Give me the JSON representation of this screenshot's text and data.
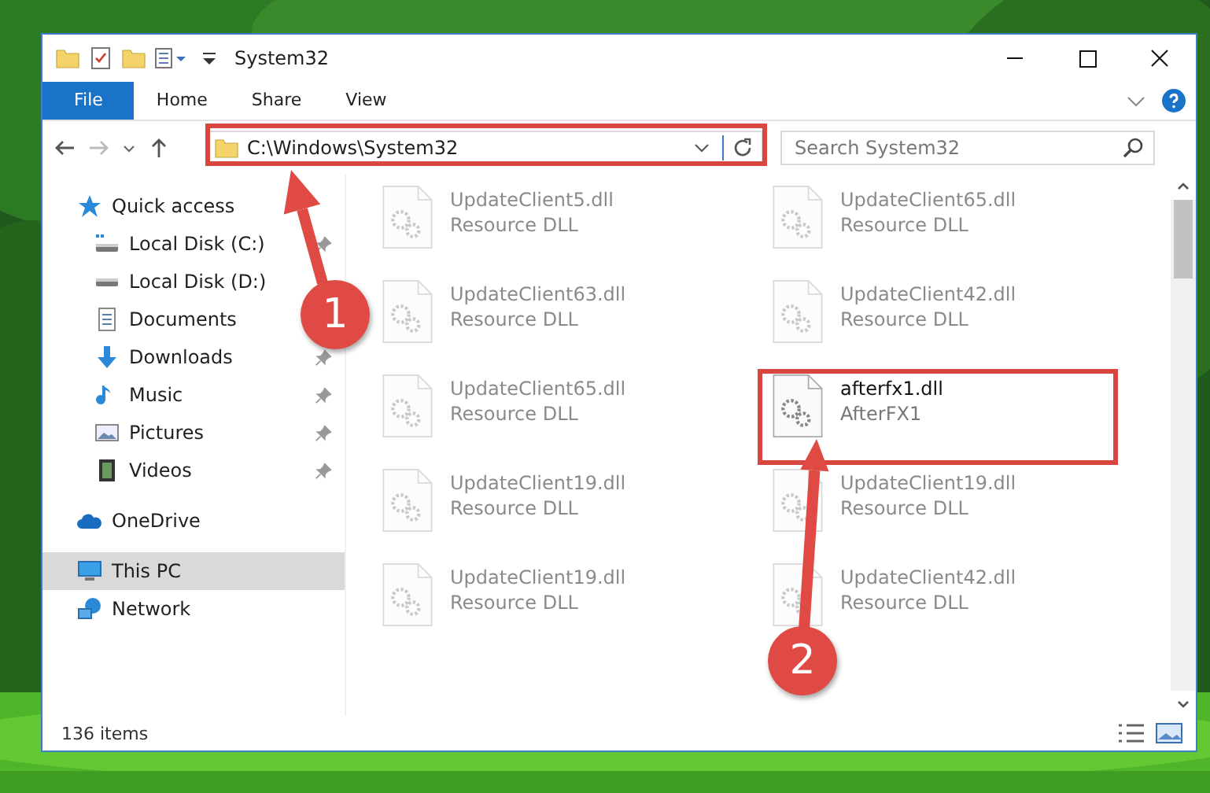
{
  "window": {
    "title": "System32"
  },
  "ribbon_tabs": [
    {
      "label": "File",
      "kind": "file",
      "selected": false
    },
    {
      "label": "Home",
      "kind": "tab",
      "selected": false
    },
    {
      "label": "Share",
      "kind": "tab",
      "selected": false
    },
    {
      "label": "View",
      "kind": "tab",
      "selected": false
    }
  ],
  "address_bar": {
    "path": "C:\\Windows\\System32"
  },
  "search": {
    "placeholder": "Search System32"
  },
  "sidebar": {
    "sections": [
      {
        "label": "Quick access",
        "kind": "star",
        "selected": false,
        "children": [
          {
            "label": "Local Disk (C:)",
            "kind": "disk-c",
            "pinned": true
          },
          {
            "label": "Local Disk (D:)",
            "kind": "disk",
            "pinned": false
          },
          {
            "label": "Documents",
            "kind": "documents",
            "pinned": false
          },
          {
            "label": "Downloads",
            "kind": "downloads",
            "pinned": true
          },
          {
            "label": "Music",
            "kind": "music",
            "pinned": true
          },
          {
            "label": "Pictures",
            "kind": "pictures",
            "pinned": true
          },
          {
            "label": "Videos",
            "kind": "videos",
            "pinned": true
          }
        ]
      },
      {
        "label": "OneDrive",
        "kind": "cloud",
        "selected": false
      },
      {
        "label": "This PC",
        "kind": "pc",
        "selected": true
      },
      {
        "label": "Network",
        "kind": "network",
        "selected": false
      }
    ]
  },
  "files": [
    {
      "name": "UpdateClient5.dll",
      "type": "Resource DLL",
      "faded": true
    },
    {
      "name": "UpdateClient65.dll",
      "type": "Resource DLL",
      "faded": true
    },
    {
      "name": "UpdateClient63.dll",
      "type": "Resource DLL",
      "faded": true
    },
    {
      "name": "UpdateClient42.dll",
      "type": "Resource DLL",
      "faded": true
    },
    {
      "name": "UpdateClient65.dll",
      "type": "Resource DLL",
      "faded": true
    },
    {
      "name": "afterfx1.dll",
      "type": "AfterFX1",
      "faded": false
    },
    {
      "name": "UpdateClient19.dll",
      "type": "Resource DLL",
      "faded": true
    },
    {
      "name": "UpdateClient19.dll",
      "type": "Resource DLL",
      "faded": true
    },
    {
      "name": "UpdateClient19.dll",
      "type": "Resource DLL",
      "faded": true
    },
    {
      "name": "UpdateClient42.dll",
      "type": "Resource DLL",
      "faded": true
    }
  ],
  "status_bar": {
    "item_count": "136 items"
  },
  "annotations": [
    {
      "number": "1"
    },
    {
      "number": "2"
    }
  ]
}
